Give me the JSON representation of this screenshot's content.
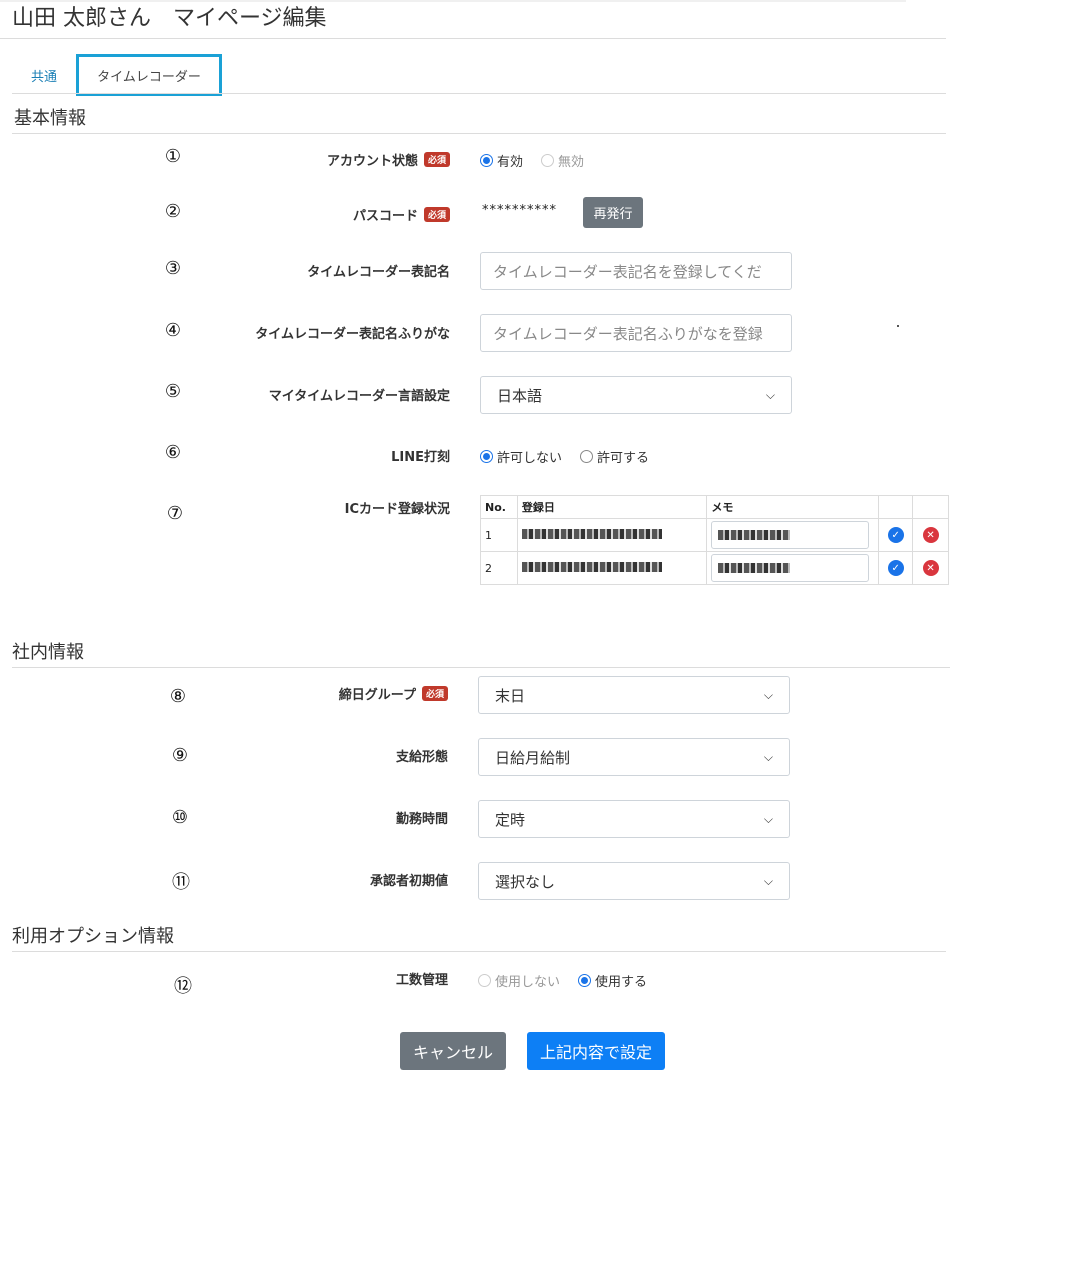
{
  "page_title": "山田 太郎さん　マイページ編集",
  "tabs": {
    "common": "共通",
    "time_recorder": "タイムレコーダー"
  },
  "sections": {
    "basic": "基本情報",
    "company": "社内情報",
    "options": "利用オプション情報"
  },
  "required_badge": "必須",
  "fields": {
    "account_status": {
      "num": "①",
      "label": "アカウント状態",
      "opt_on": "有効",
      "opt_off": "無効"
    },
    "passcode": {
      "num": "②",
      "label": "パスコード",
      "value": "**********",
      "button": "再発行"
    },
    "display_name": {
      "num": "③",
      "label": "タイムレコーダー表記名",
      "placeholder": "タイムレコーダー表記名を登録してくだ"
    },
    "display_kana": {
      "num": "④",
      "label": "タイムレコーダー表記名ふりがな",
      "placeholder": "タイムレコーダー表記名ふりがなを登録"
    },
    "language": {
      "num": "⑤",
      "label": "マイタイムレコーダー言語設定",
      "value": "日本語"
    },
    "line": {
      "num": "⑥",
      "label": "LINE打刻",
      "opt_no": "許可しない",
      "opt_yes": "許可する"
    },
    "ic_card": {
      "num": "⑦",
      "label": "ICカード登録状況",
      "headers": [
        "No.",
        "登録日",
        "メモ"
      ],
      "rows": [
        {
          "no": "1"
        },
        {
          "no": "2"
        }
      ]
    },
    "closing_group": {
      "num": "⑧",
      "label": "締日グループ",
      "value": "末日"
    },
    "pay_type": {
      "num": "⑨",
      "label": "支給形態",
      "value": "日給月給制"
    },
    "work_time": {
      "num": "⑩",
      "label": "勤務時間",
      "value": "定時"
    },
    "approver": {
      "num": "⑪",
      "label": "承認者初期値",
      "value": "選択なし"
    },
    "man_hours": {
      "num": "⑫",
      "label": "工数管理",
      "opt_no": "使用しない",
      "opt_yes": "使用する"
    }
  },
  "buttons": {
    "cancel": "キャンセル",
    "submit": "上記内容で設定"
  },
  "colors": {
    "accent": "#0d7ff5",
    "tab_border": "#1aa1d6",
    "required": "#c0392b",
    "gray_button": "#6c757d"
  },
  "icons": {
    "check": "check-circle-icon",
    "delete": "x-circle-icon",
    "chevron": "chevron-down-icon"
  }
}
